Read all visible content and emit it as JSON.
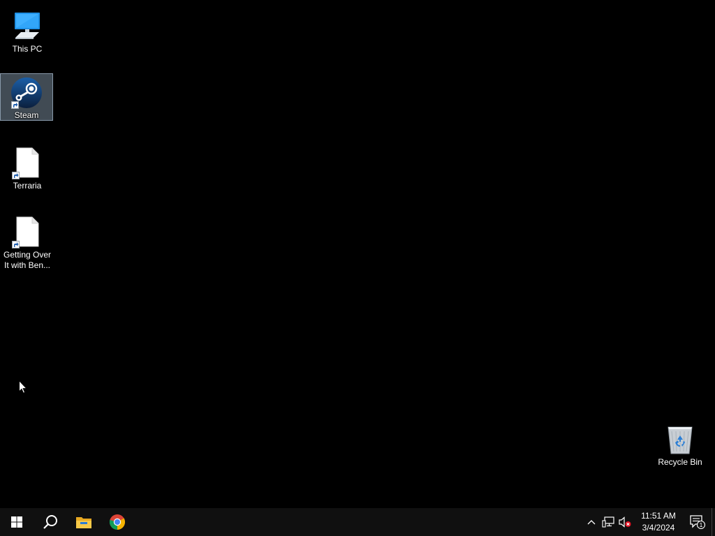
{
  "desktop": {
    "background_color": "#000000",
    "icons": [
      {
        "label": "This PC",
        "icon": "this-pc-icon"
      },
      {
        "label": "Steam",
        "icon": "steam-icon",
        "selected": true
      },
      {
        "label": "Terraria",
        "icon": "file-shortcut-icon"
      },
      {
        "label": "Getting Over It with Ben...",
        "icon": "file-shortcut-icon"
      },
      {
        "label": "Recycle Bin",
        "icon": "recycle-bin-icon"
      }
    ]
  },
  "taskbar": {
    "background_color": "#101010",
    "pinned": [
      {
        "name": "Start",
        "icon": "windows-start-icon"
      },
      {
        "name": "Search",
        "icon": "search-icon"
      },
      {
        "name": "File Explorer",
        "icon": "folder-icon"
      },
      {
        "name": "Google Chrome",
        "icon": "chrome-icon"
      }
    ],
    "tray": {
      "icons": [
        "chevron-up-icon",
        "network-icon",
        "volume-muted-icon"
      ],
      "time": "11:51 AM",
      "date": "3/4/2024",
      "notification_count": "1"
    }
  }
}
